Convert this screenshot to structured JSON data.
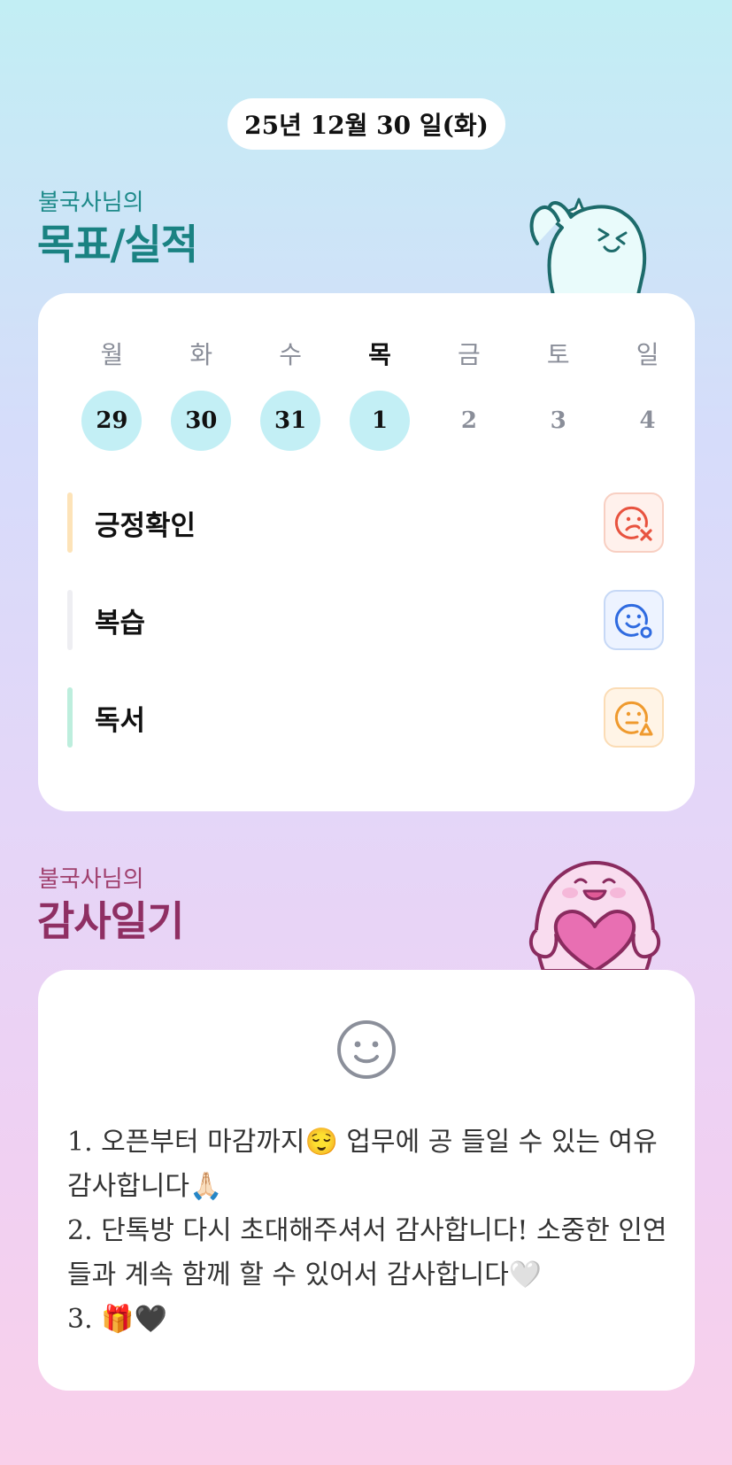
{
  "header": {
    "date": "25년 12월 30 일(화)"
  },
  "goals_section": {
    "subtitle": "불국사님의",
    "title": "목표/실적",
    "weekdays": [
      "월",
      "화",
      "수",
      "목",
      "금",
      "토",
      "일"
    ],
    "days": [
      "29",
      "30",
      "31",
      "1",
      "2",
      "3",
      "4"
    ],
    "goals": [
      {
        "label": "긍정확인",
        "bar_color": "#fde3b8",
        "status_icon": "frown-x-icon",
        "status_color": "#e8533f"
      },
      {
        "label": "복습",
        "bar_color": "#eeeef2",
        "status_icon": "smile-check-icon",
        "status_color": "#2f6be0"
      },
      {
        "label": "독서",
        "bar_color": "#bdeedd",
        "status_icon": "neutral-triangle-icon",
        "status_color": "#ef9a2e"
      }
    ]
  },
  "gratitude_section": {
    "subtitle": "불국사님의",
    "title": "감사일기",
    "entries": [
      "1. 오픈부터 마감까지😌 업무에 공 들일 수 있는 여유 감사합니다🙏🏻",
      "2. 단톡방 다시 초대해주셔서 감사합니다! 소중한 인연들과 계속 함께 할 수 있어서 감사합니다🤍",
      "3. 🎁🖤"
    ]
  }
}
